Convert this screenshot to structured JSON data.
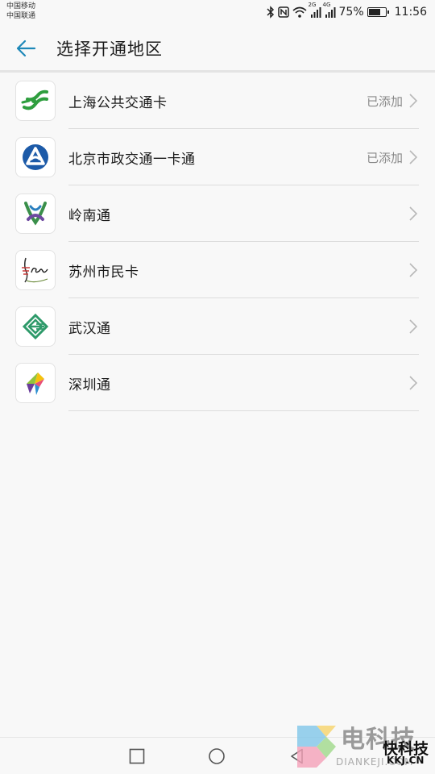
{
  "status_bar": {
    "carrier_1": "中国移动",
    "carrier_2": "中国联通",
    "network_2g": "2G",
    "network_4g": "4G",
    "battery_percent": "75%",
    "battery_level": 0.75,
    "time": "11:56",
    "icons": [
      "bluetooth-icon",
      "nfc-icon",
      "wifi-icon",
      "signal-icon",
      "battery-icon"
    ]
  },
  "app_bar": {
    "back_icon": "arrow-left-icon",
    "title": "选择开通地区",
    "accent_color": "#1e88b8"
  },
  "regions": [
    {
      "name": "上海公共交通卡",
      "status": "已添加",
      "logo": "shanghai-card-logo"
    },
    {
      "name": "北京市政交通一卡通",
      "status": "已添加",
      "logo": "beijing-card-logo"
    },
    {
      "name": "岭南通",
      "status": "",
      "logo": "lingnan-card-logo"
    },
    {
      "name": "苏州市民卡",
      "status": "",
      "logo": "suzhou-card-logo"
    },
    {
      "name": "武汉通",
      "status": "",
      "logo": "wuhan-card-logo"
    },
    {
      "name": "深圳通",
      "status": "",
      "logo": "shenzhen-card-logo"
    }
  ],
  "nav_bar": {
    "buttons": [
      "recent-apps-icon",
      "home-icon",
      "back-icon"
    ]
  },
  "watermark": {
    "line1": "电科技",
    "line2": "DIANKEJI.COM",
    "line3": "快科技",
    "line4": "KKJ.CN"
  }
}
